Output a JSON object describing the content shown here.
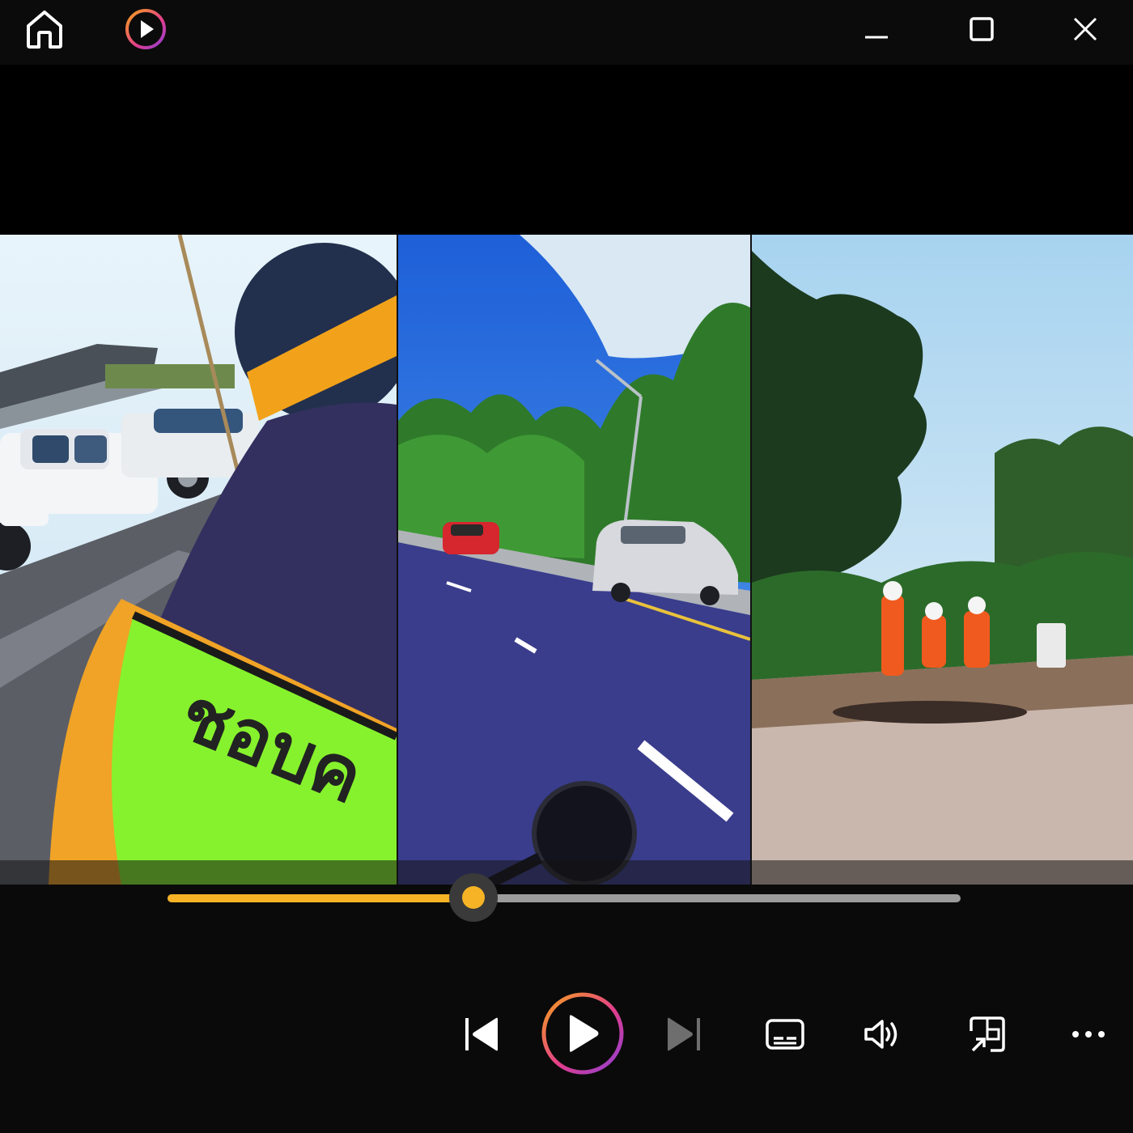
{
  "window": {
    "controls": {
      "home_icon": "home-icon",
      "app_logo_icon": "play-logo-icon",
      "minimize_icon": "minimize-icon",
      "maximize_icon": "maximize-icon",
      "close_icon": "close-icon"
    }
  },
  "video": {
    "panels": [
      {
        "name": "panel-left",
        "description_icon": "video-frame"
      },
      {
        "name": "panel-middle",
        "description_icon": "video-frame"
      },
      {
        "name": "panel-right",
        "description_icon": "video-frame"
      }
    ],
    "frame_text": "ชอบค"
  },
  "player": {
    "progress": 0.386,
    "accent_color": "#f5b325",
    "play_ring_gradient": [
      "#f7a21b",
      "#e23d8c",
      "#8b3fd6"
    ],
    "buttons": {
      "previous": "skip-previous-icon",
      "play": "play-icon",
      "next": "skip-next-icon",
      "subtitles": "subtitles-icon",
      "volume": "volume-icon",
      "miniplayer": "miniplayer-icon",
      "more": "more-options-icon"
    }
  }
}
